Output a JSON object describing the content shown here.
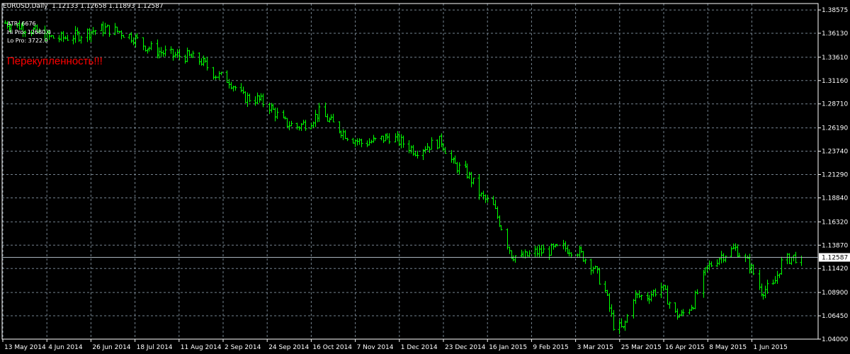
{
  "header": {
    "symbol_label": "EURUSD,Daily",
    "ohlc": "1.12133 1.12658 1.11893 1.12587"
  },
  "indicators": {
    "atr": "ATR: 6676",
    "hi_pro": "Hi Pro: 12680.0",
    "lo_pro": "Lo Pro: 3722.0"
  },
  "annotation": "Перекупленность!!!",
  "colors": {
    "background": "#000000",
    "bars": "#00ff00",
    "grid": "#8a9aa8",
    "axis": "#ffffff",
    "price_line": "#a9b3bd",
    "price_tag_bg": "#ffffff",
    "price_tag_fg": "#000000",
    "annotation": "#ff0000"
  },
  "chart_data": {
    "type": "ohlc",
    "title": "EURUSD,Daily",
    "current_price": 1.12587,
    "ylim": [
      1.04,
      1.3925
    ],
    "y_ticks": [
      "1.38575",
      "1.36130",
      "1.33610",
      "1.31160",
      "1.28710",
      "1.26190",
      "1.23740",
      "1.21290",
      "1.18840",
      "1.16320",
      "1.13870",
      "1.11420",
      "1.08900",
      "1.06450",
      "1.04000"
    ],
    "x_ticks": [
      "13 May 2014",
      "4 Jun 2014",
      "26 Jun 2014",
      "18 Jul 2014",
      "11 Aug 2014",
      "2 Sep 2014",
      "24 Sep 2014",
      "16 Oct 2014",
      "7 Nov 2014",
      "1 Dec 2014",
      "23 Dec 2014",
      "16 Jan 2015",
      "9 Feb 2015",
      "3 Mar 2015",
      "25 Mar 2015",
      "16 Apr 2015",
      "8 May 2015",
      "1 Jun 2015"
    ],
    "grid": true,
    "price_path": [
      [
        "2014-05-13",
        1.372
      ],
      [
        "2014-05-20",
        1.369
      ],
      [
        "2014-05-27",
        1.364
      ],
      [
        "2014-06-04",
        1.357
      ],
      [
        "2014-06-10",
        1.356
      ],
      [
        "2014-06-18",
        1.359
      ],
      [
        "2014-06-26",
        1.364
      ],
      [
        "2014-07-02",
        1.366
      ],
      [
        "2014-07-09",
        1.363
      ],
      [
        "2014-07-16",
        1.357
      ],
      [
        "2014-07-22",
        1.348
      ],
      [
        "2014-07-29",
        1.342
      ],
      [
        "2014-08-05",
        1.338
      ],
      [
        "2014-08-12",
        1.337
      ],
      [
        "2014-08-19",
        1.332
      ],
      [
        "2014-08-26",
        1.318
      ],
      [
        "2014-09-02",
        1.312
      ],
      [
        "2014-09-09",
        1.294
      ],
      [
        "2014-09-16",
        1.292
      ],
      [
        "2014-09-22",
        1.285
      ],
      [
        "2014-09-29",
        1.268
      ],
      [
        "2014-10-06",
        1.263
      ],
      [
        "2014-10-13",
        1.27
      ],
      [
        "2014-10-17",
        1.278
      ],
      [
        "2014-10-24",
        1.266
      ],
      [
        "2014-10-31",
        1.254
      ],
      [
        "2014-11-07",
        1.246
      ],
      [
        "2014-11-14",
        1.248
      ],
      [
        "2014-11-21",
        1.253
      ],
      [
        "2014-11-28",
        1.246
      ],
      [
        "2014-12-04",
        1.238
      ],
      [
        "2014-12-10",
        1.243
      ],
      [
        "2014-12-17",
        1.248
      ],
      [
        "2014-12-23",
        1.224
      ],
      [
        "2014-12-30",
        1.214
      ],
      [
        "2015-01-06",
        1.19
      ],
      [
        "2015-01-12",
        1.179
      ],
      [
        "2015-01-16",
        1.158
      ],
      [
        "2015-01-21",
        1.129
      ],
      [
        "2015-01-26",
        1.125
      ],
      [
        "2015-02-02",
        1.131
      ],
      [
        "2015-02-09",
        1.133
      ],
      [
        "2015-02-16",
        1.136
      ],
      [
        "2015-02-23",
        1.133
      ],
      [
        "2015-03-03",
        1.116
      ],
      [
        "2015-03-09",
        1.09
      ],
      [
        "2015-03-13",
        1.055
      ],
      [
        "2015-03-18",
        1.05
      ],
      [
        "2015-03-23",
        1.085
      ],
      [
        "2015-03-30",
        1.085
      ],
      [
        "2015-04-06",
        1.095
      ],
      [
        "2015-04-13",
        1.066
      ],
      [
        "2015-04-16",
        1.065
      ],
      [
        "2015-04-22",
        1.078
      ],
      [
        "2015-04-29",
        1.115
      ],
      [
        "2015-05-06",
        1.128
      ],
      [
        "2015-05-13",
        1.135
      ],
      [
        "2015-05-20",
        1.118
      ],
      [
        "2015-05-26",
        1.091
      ],
      [
        "2015-06-01",
        1.095
      ],
      [
        "2015-06-05",
        1.12
      ],
      [
        "2015-06-10",
        1.126
      ],
      [
        "2015-06-15",
        1.1259
      ]
    ]
  }
}
